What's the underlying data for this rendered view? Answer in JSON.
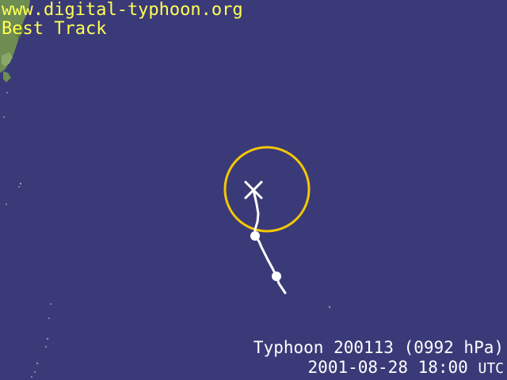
{
  "header": {
    "site_url": "www.digital-typhoon.org",
    "product": "Best Track"
  },
  "footer": {
    "storm_label": "Typhoon 200113 (0992 hPa)",
    "datetime": "2001-08-28 18:00",
    "timezone": "UTC"
  },
  "colors": {
    "ocean": "#3b3a78",
    "land": "#6e8d52",
    "header_text": "#ffff55",
    "footer_text": "#ffffff",
    "track": "#ffffff",
    "wind_circle": "#f5c800"
  },
  "markers": {
    "current_position": "x-mark-icon",
    "past_positions": "dot-icon"
  }
}
